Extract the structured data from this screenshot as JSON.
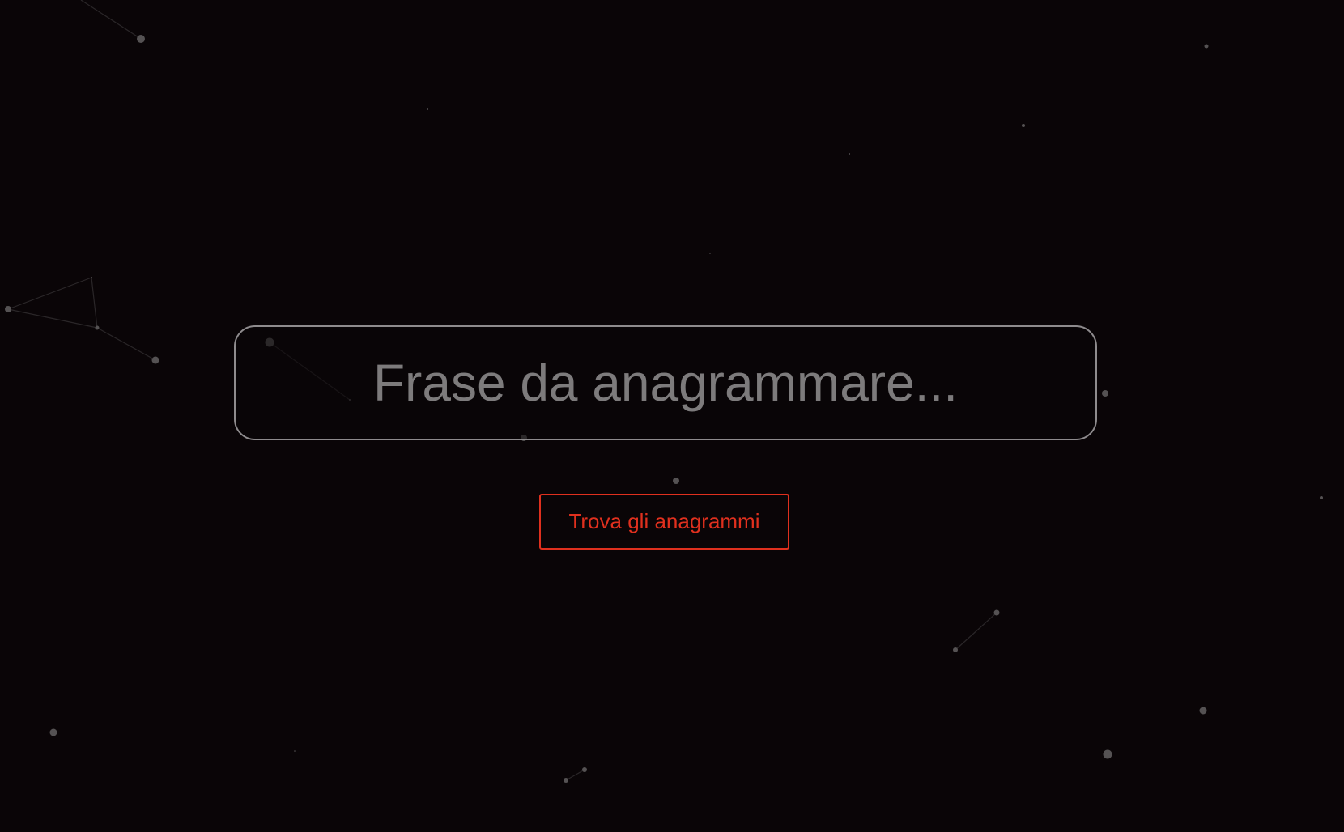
{
  "colors": {
    "background": "#0a0507",
    "accent": "#e0301e",
    "input_border": "#8e8b8d",
    "placeholder": "#7d7b7c",
    "star": "#555253",
    "constellation_line": "#2a2628"
  },
  "search": {
    "placeholder": "Frase da anagrammare...",
    "value": ""
  },
  "actions": {
    "find_label": "Trova gli anagrammi"
  }
}
